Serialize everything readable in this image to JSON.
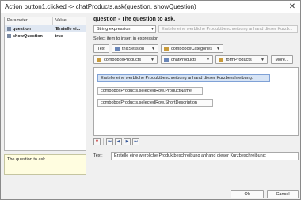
{
  "window": {
    "title": "Action button1.clicked -> chatProducts.ask(question, showQuestion)",
    "close_glyph": "✕"
  },
  "params": {
    "headers": [
      "Parameter",
      "Value"
    ],
    "rows": [
      {
        "name": "question",
        "value": "'Erstelle ei..."
      },
      {
        "name": "showQuestion",
        "value": "true"
      }
    ],
    "description": "The question to ask."
  },
  "editor": {
    "title": "question - The question to ask.",
    "mode": "String expression",
    "readonly_value": "Erstelle eine werbliche Produktbeschreibung anhand dieser Kurzb...",
    "hint": "Select item to insert in expression",
    "buttons_row1": [
      "Text",
      "thisSession",
      "comboboxCategories"
    ],
    "buttons_row2": [
      "comboboxProducts",
      "chatProducts",
      "formProducts",
      "More..."
    ],
    "chips": [
      "Erstelle eine werbliche Produktbeschreibung anhand dieser Kurzbeschreibung:",
      "comboboxProducts.selectedRow.ProductName",
      "comboboxProducts.selectedRow.ShortDescription"
    ],
    "nav": [
      "✕",
      "⏮",
      "◀",
      "▶",
      "⏭"
    ],
    "text_label": "Text:",
    "text_value": "Erstelle eine werbliche Produktbeschreibung anhand dieser Kurzbeschreibung:"
  },
  "footer": {
    "ok": "Ok",
    "cancel": "Cancel"
  }
}
